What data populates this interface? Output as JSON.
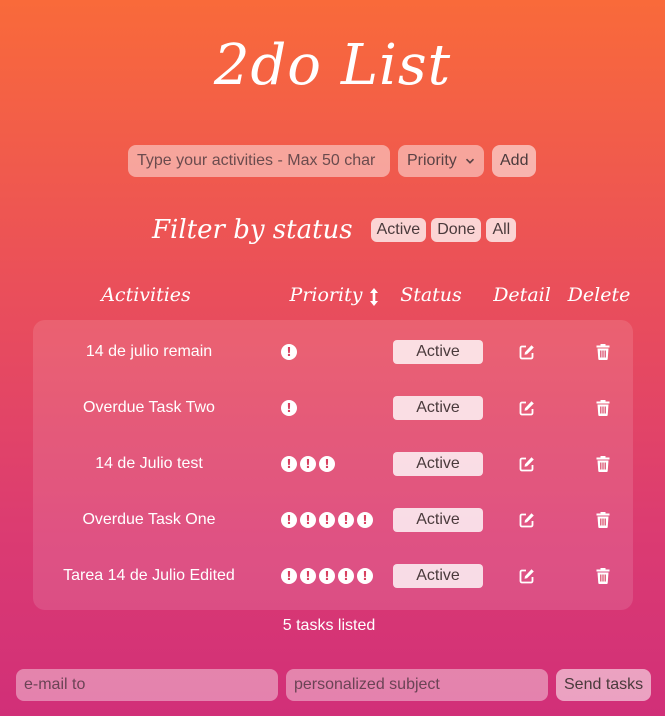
{
  "app": {
    "title": "2do List"
  },
  "add_form": {
    "activity_placeholder": "Type your activities - Max 50 char",
    "priority_select": "Priority",
    "add_label": "Add"
  },
  "filter": {
    "label": "Filter by status",
    "options": [
      "Active",
      "Done",
      "All"
    ]
  },
  "table": {
    "headers": {
      "activities": "Activities",
      "priority": "Priority",
      "priority_sort_icon": "sort-arrows-icon",
      "status": "Status",
      "detail": "Detail",
      "delete": "Delete"
    },
    "rows": [
      {
        "activity": "14 de julio remain",
        "priority": 1,
        "status": "Active"
      },
      {
        "activity": "Overdue Task Two",
        "priority": 1,
        "status": "Active"
      },
      {
        "activity": "14 de Julio test",
        "priority": 3,
        "status": "Active"
      },
      {
        "activity": "Overdue Task One",
        "priority": 5,
        "status": "Active"
      },
      {
        "activity": "Tarea 14 de Julio Edited",
        "priority": 5,
        "status": "Active"
      }
    ]
  },
  "summary": {
    "count_text": "5 tasks listed"
  },
  "mail_form": {
    "email_placeholder": "e-mail to",
    "subject_placeholder": "personalized subject",
    "send_label": "Send tasks"
  },
  "colors": {
    "gradient_top": "#f96a3a",
    "gradient_bottom": "#d12f78",
    "text": "#ffffff"
  }
}
